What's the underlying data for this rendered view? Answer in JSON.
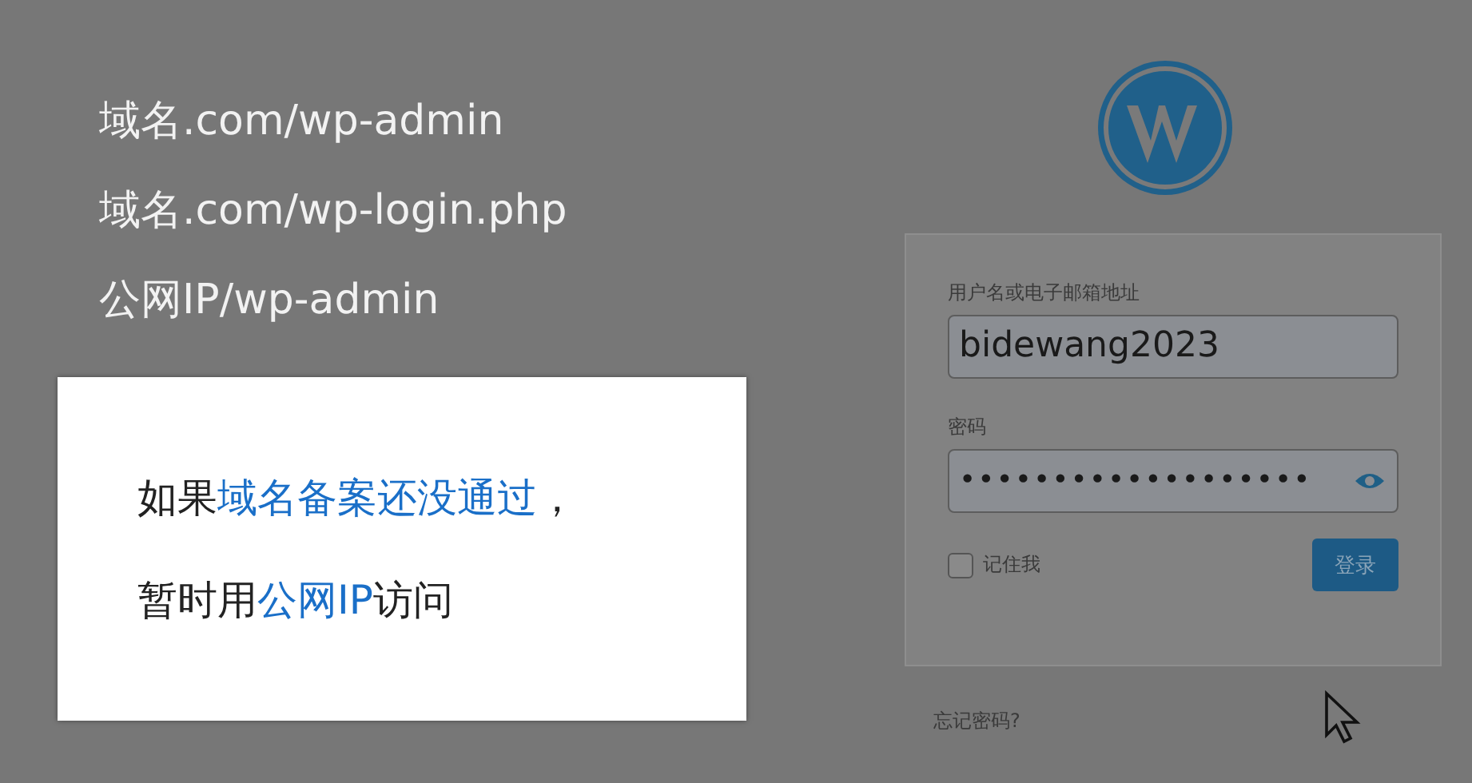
{
  "url_lines": [
    "域名.com/wp-admin",
    "域名.com/wp-login.php",
    "公网IP/wp-admin"
  ],
  "note": {
    "lines": [
      {
        "segments": [
          {
            "text": "如果",
            "highlight": false
          },
          {
            "text": "域名备案还没通过",
            "highlight": true
          },
          {
            "text": "，",
            "highlight": false
          }
        ]
      },
      {
        "segments": [
          {
            "text": "暂时用",
            "highlight": false
          },
          {
            "text": "公网IP",
            "highlight": true
          },
          {
            "text": "访问",
            "highlight": false
          }
        ]
      }
    ]
  },
  "login": {
    "username_label": "用户名或电子邮箱地址",
    "username": "bidewang2023",
    "password_label": "密码",
    "password": "•••••••••••••••••••",
    "remember": {
      "label": "记住我",
      "checked": false
    },
    "submit": "登录",
    "forgot": "忘记密码?"
  }
}
